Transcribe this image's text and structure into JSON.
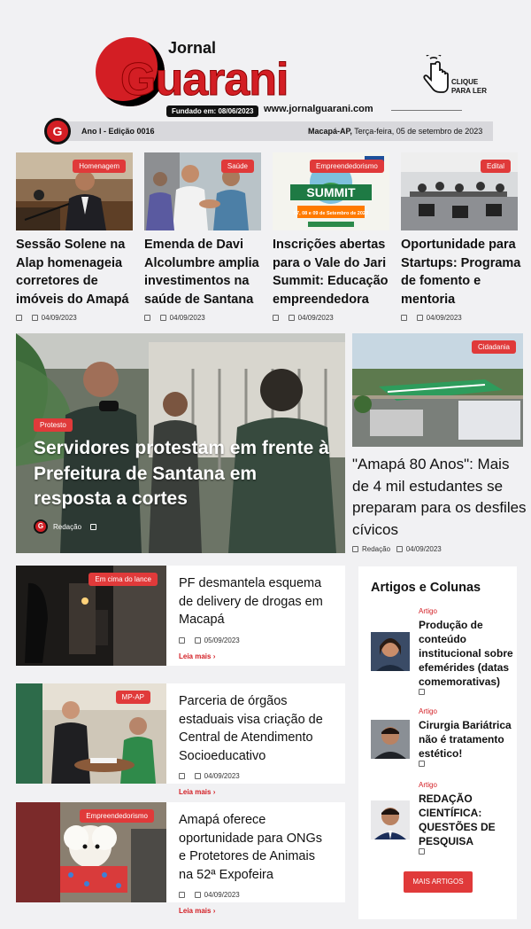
{
  "header": {
    "brand_top": "Jornal",
    "brand_main": "Guarani",
    "founded": "Fundado em: 08/06/2023",
    "url": "www.jornalguarani.com",
    "click_cta": "CLIQUE PARA LER",
    "edition": "Ano I - Edição 0016",
    "city": "Macapá-AP,",
    "date": "Terça-feira, 05 de setembro de 2023"
  },
  "top_cards": [
    {
      "category": "Homenagem",
      "title": "Sessão Solene na Alap homenageia corretores de imóveis do Amapá",
      "date": "04/09/2023"
    },
    {
      "category": "Saúde",
      "title": "Emenda de Davi Alcolumbre amplia investimentos na saúde de Santana",
      "date": "04/09/2023"
    },
    {
      "category": "Empreendedorismo",
      "title": "Inscrições abertas para o Vale do Jari Summit: Educação empreendedora",
      "date": "04/09/2023",
      "poster_text": "SUMMIT",
      "poster_date": "07, 08 e 09 de Setembro de 2023"
    },
    {
      "category": "Edital",
      "title": "Oportunidade para Startups: Programa de fomento e mentoria",
      "date": "04/09/2023"
    }
  ],
  "hero": {
    "category": "Protesto",
    "title": "Servidores protestam em frente à Prefeitura de Santana em resposta a cortes",
    "author": "Redação"
  },
  "side_story": {
    "category": "Cidadania",
    "title": "\"Amapá 80 Anos\": Mais de 4 mil estudantes se preparam para os desfiles cívicos",
    "author": "Redação",
    "date": "04/09/2023"
  },
  "list_stories": [
    {
      "category": "Em cima do lance",
      "title": "PF desmantela esquema de delivery de drogas em Macapá",
      "date": "05/09/2023",
      "more": "Leia mais ›"
    },
    {
      "category": "MP-AP",
      "title": "Parceria de órgãos estaduais visa criação de Central de Atendimento Socioeducativo",
      "date": "04/09/2023",
      "more": "Leia mais ›"
    },
    {
      "category": "Empreendedorismo",
      "title": "Amapá oferece oportunidade para ONGs e Protetores de Animais na 52ª Expofeira",
      "date": "04/09/2023",
      "more": "Leia mais ›"
    }
  ],
  "articles": {
    "heading": "Artigos e Colunas",
    "items": [
      {
        "category": "Artigo",
        "title": "Produção de conteúdo institucional sobre efemérides (datas comemorativas)"
      },
      {
        "category": "Artigo",
        "title": "Cirurgia Bariátrica não é tratamento estético!"
      },
      {
        "category": "Artigo",
        "title": "REDAÇÃO CIENTÍFICA: QUESTÕES DE PESQUISA"
      }
    ],
    "more_button": "MAIS ARTIGOS"
  }
}
